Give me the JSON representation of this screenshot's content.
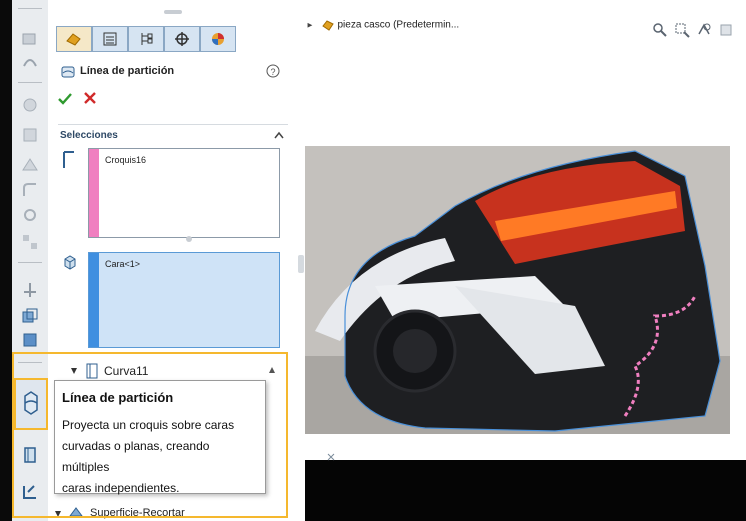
{
  "breadcrumb": {
    "label": "pieza casco (Predetermin..."
  },
  "property_manager": {
    "tabs": [
      "feature-manager",
      "property-manager",
      "configuration-manager",
      "dimxpert-manager",
      "display-manager"
    ],
    "title": "Línea de partición",
    "help_icon": "help-icon",
    "ok_icon": "check-icon",
    "cancel_icon": "close-icon",
    "section_label": "Selecciones",
    "selection1": {
      "value": "Croquis16",
      "color": "#f07fc0"
    },
    "selection2": {
      "value": "Cara<1>",
      "color": "#3f8fe0"
    }
  },
  "feature_tree": {
    "curve_item": "Curva11",
    "surface_item": "Superficie-Recortar"
  },
  "tooltip": {
    "title": "Línea de partición",
    "line1": "Proyecta un croquis sobre caras",
    "line2": "curvadas o planas, creando múltiples",
    "line3": "caras independientes."
  },
  "colors": {
    "accent": "#f5b82e",
    "selection_bg": "#cfe3f7"
  }
}
